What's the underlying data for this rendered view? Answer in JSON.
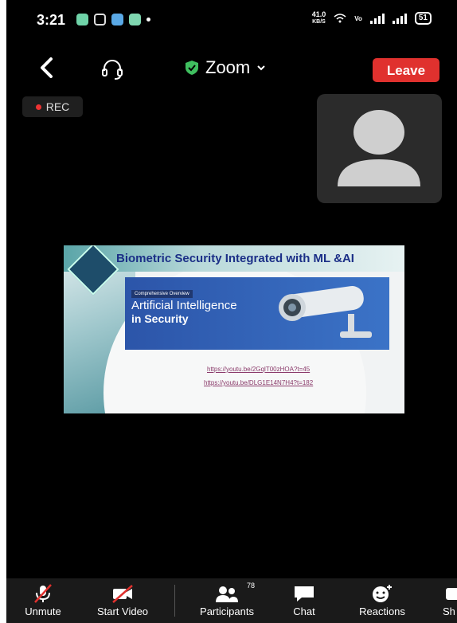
{
  "status_bar": {
    "time": "3:21",
    "speed_value": "41.0",
    "speed_unit": "KB/S",
    "battery": "51"
  },
  "meeting": {
    "title": "Zoom",
    "leave_label": "Leave",
    "rec_label": "REC"
  },
  "shared_slide": {
    "title": "Biometric Security Integrated with ML &AI",
    "tag": "Comprehensive Overview",
    "banner_line1": "Artificial Intelligence",
    "banner_line2": "in Security",
    "link1": "https://youtu.be/2GqlT00zHOA?t=45",
    "link2": "https://youtu.be/DLG1E14N7H4?t=182"
  },
  "toolbar": {
    "unmute": "Unmute",
    "start_video": "Start Video",
    "participants": "Participants",
    "participant_count": "78",
    "chat": "Chat",
    "reactions": "Reactions",
    "share": "Sh"
  },
  "colors": {
    "leave": "#e0312e",
    "background": "#000000",
    "toolbar": "#1a1a1a",
    "secure_shield": "#3fbf5f"
  }
}
